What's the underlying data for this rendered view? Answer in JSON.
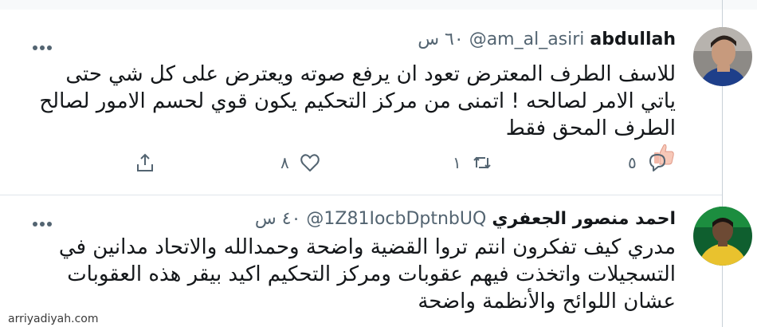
{
  "tweets": [
    {
      "name": "abdullah",
      "handle": "@am_al_asiri",
      "time": "٦٠ س",
      "text": "للاسف الطرف المعترض تعود ان يرفع صوته ويعترض على كل شي حتى ياتي الامر لصالحه ! اتمنى من مركز التحكيم يكون قوي لحسم الامور لصالح الطرف المحق فقط",
      "emoji": "thumbs-up-icon",
      "reply_count": "٥",
      "retweet_count": "١",
      "like_count": "٨"
    },
    {
      "name": "احمد منصور الجعفري",
      "handle": "@1Z81IocbDptnbUQ",
      "time": "٤٠ س",
      "text": "مدري كيف تفكرون انتم تروا القضية واضحة وحمدالله والاتحاد مدانين في التسجيلات واتخذت فيهم عقوبات ومركز التحكيم اكيد بيقر هذه العقوبات عشان اللوائح والأنظمة واضحة"
    }
  ],
  "watermark": "arriyadiyah.com",
  "colors": {
    "text": "#14171a",
    "secondary": "#536471",
    "divider": "#dfe5ea",
    "vertical_line": "#c9d1d7"
  }
}
